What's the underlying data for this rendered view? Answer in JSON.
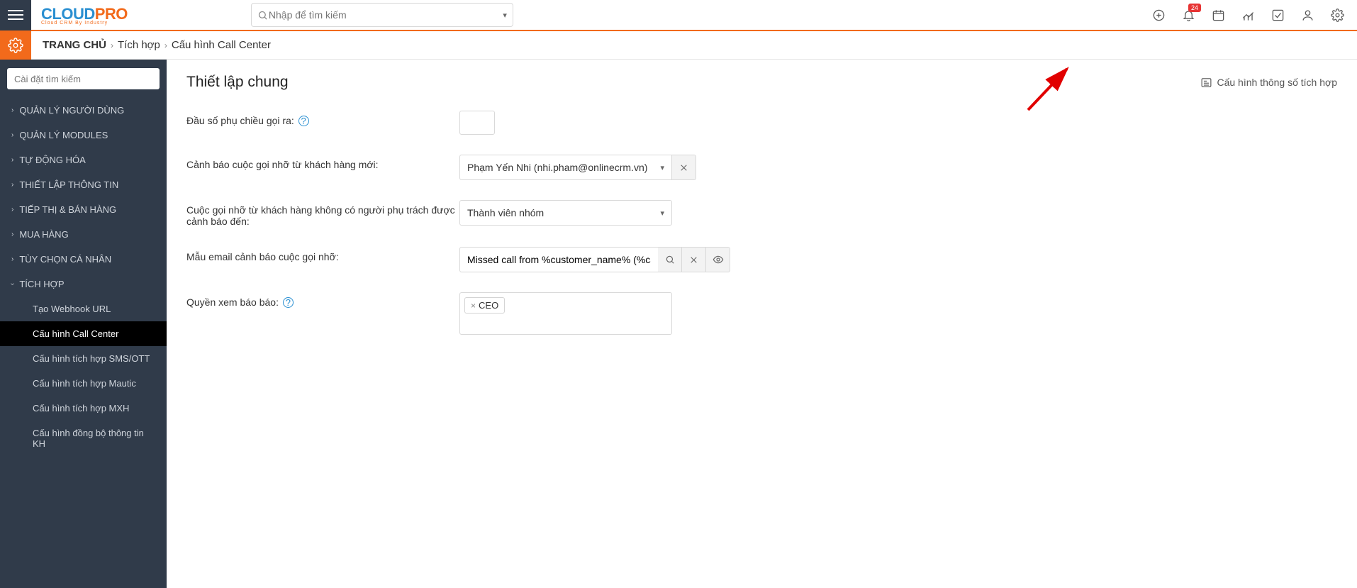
{
  "topbar": {
    "search_placeholder": "Nhập để tìm kiếm",
    "notification_badge": "24"
  },
  "logo": {
    "part1": "CLOUD",
    "part2": "PRO",
    "sub": "Cloud CRM By Industry"
  },
  "breadcrumb": {
    "home": "TRANG CHỦ",
    "level1": "Tích hợp",
    "level2": "Cấu hình Call Center"
  },
  "sidebar": {
    "search_placeholder": "Cài đặt tìm kiếm",
    "items": [
      "QUẢN LÝ NGƯỜI DÙNG",
      "QUẢN LÝ MODULES",
      "TỰ ĐỘNG HÓA",
      "THIẾT LẬP THÔNG TIN",
      "TIẾP THỊ & BÁN HÀNG",
      "MUA HÀNG",
      "TÙY CHỌN CÁ NHÂN",
      "TÍCH HỢP"
    ],
    "subitems": [
      "Tạo Webhook URL",
      "Cấu hình Call Center",
      "Cấu hình tích hợp SMS/OTT",
      "Cấu hình tích hợp Mautic",
      "Cấu hình tích hợp MXH",
      "Cấu hình đồng bộ thông tin KH"
    ]
  },
  "content": {
    "title": "Thiết lập chung",
    "header_link": "Cấu hình thông số tích hợp",
    "labels": {
      "outbound_prefix": "Đầu số phụ chiều gọi ra:",
      "new_customer_alert": "Cảnh báo cuộc gọi nhỡ từ khách hàng mới:",
      "no_owner_alert": "Cuộc gọi nhỡ từ khách hàng không có người phụ trách được cảnh báo đến:",
      "email_template": "Mẫu email cảnh báo cuộc gọi nhỡ:",
      "report_permission": "Quyền xem báo báo:"
    },
    "values": {
      "new_customer_alert": "Phạm Yến Nhi (nhi.pham@onlinecrm.vn)",
      "no_owner_alert": "Thành viên nhóm",
      "email_template": "Missed call from %customer_name% (%cal",
      "report_tag": "CEO"
    }
  }
}
